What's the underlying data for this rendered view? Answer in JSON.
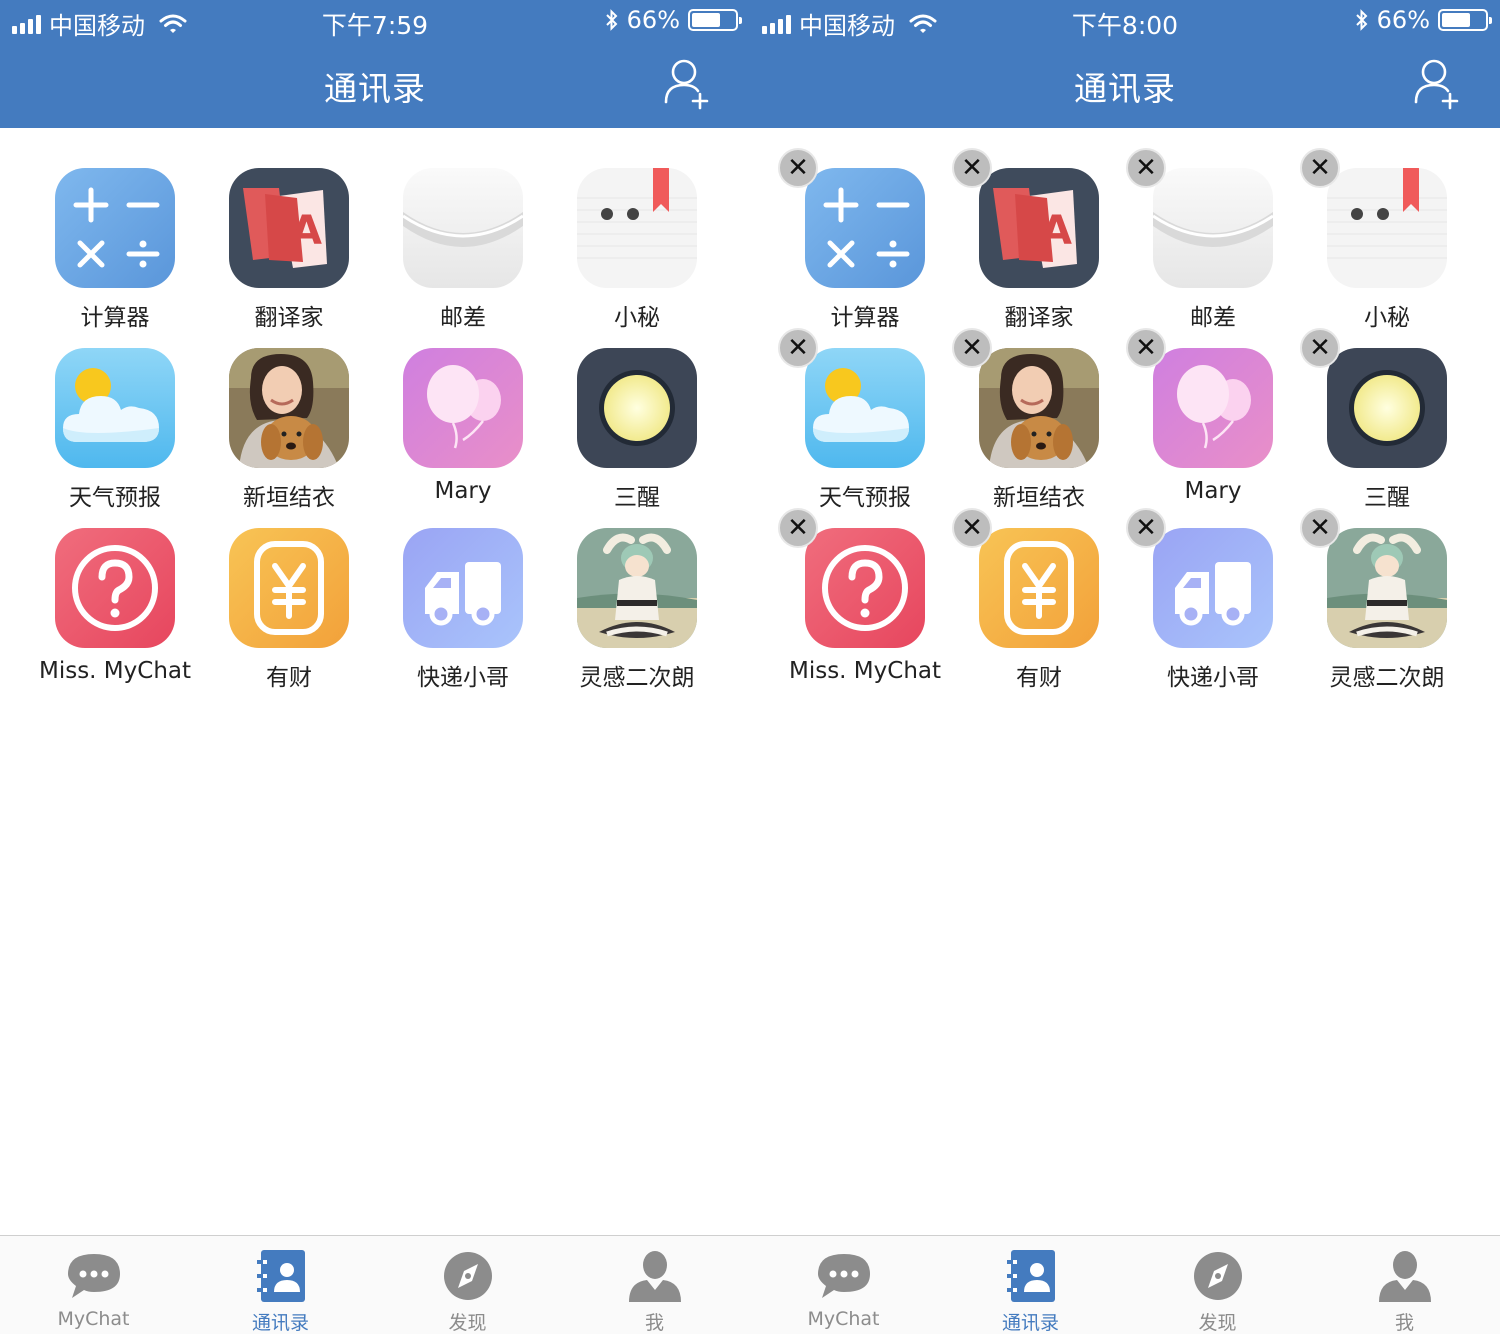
{
  "screens": [
    {
      "status": {
        "carrier": "中国移动",
        "time": "下午7:59",
        "battery": "66%"
      },
      "header": {
        "title": "通讯录"
      },
      "edit_mode": false
    },
    {
      "status": {
        "carrier": "中国移动",
        "time": "下午8:00",
        "battery": "66%"
      },
      "header": {
        "title": "通讯录"
      },
      "edit_mode": true
    }
  ],
  "apps": [
    {
      "name": "计算器",
      "icon": "calculator-icon"
    },
    {
      "name": "翻译家",
      "icon": "translator-icon"
    },
    {
      "name": "邮差",
      "icon": "envelope-icon"
    },
    {
      "name": "小秘",
      "icon": "notebook-icon"
    },
    {
      "name": "天气预报",
      "icon": "weather-icon"
    },
    {
      "name": "新垣结衣",
      "icon": "portrait-photo"
    },
    {
      "name": "Mary",
      "icon": "balloon-icon"
    },
    {
      "name": "三醒",
      "icon": "moon-icon"
    },
    {
      "name": "Miss. MyChat",
      "icon": "help-icon"
    },
    {
      "name": "有财",
      "icon": "yen-icon"
    },
    {
      "name": "快递小哥",
      "icon": "truck-icon"
    },
    {
      "name": "灵感二次朗",
      "icon": "anime-photo"
    }
  ],
  "tabs": [
    {
      "label": "MyChat",
      "icon": "chat-bubble-icon",
      "active": false
    },
    {
      "label": "通讯录",
      "icon": "contacts-book-icon",
      "active": true
    },
    {
      "label": "发现",
      "icon": "compass-icon",
      "active": false
    },
    {
      "label": "我",
      "icon": "person-icon",
      "active": false
    }
  ],
  "delete_symbol": "✕",
  "colors": {
    "header_bg": "#447bbf",
    "tab_active": "#447bbf",
    "tab_inactive": "#8c8c8c"
  }
}
